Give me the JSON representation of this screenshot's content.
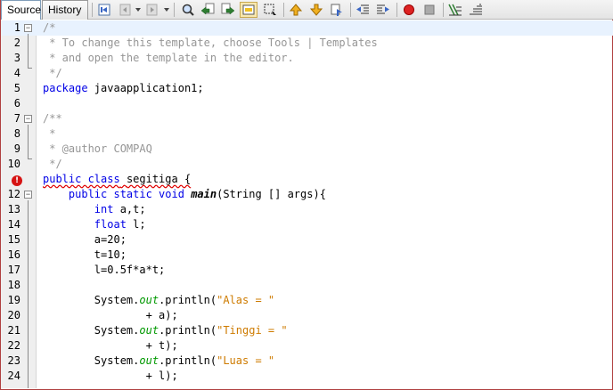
{
  "tabs": {
    "source": "Source",
    "history": "History"
  },
  "toolbar_icons": [
    "last-edit-icon",
    "back-icon",
    "forward-icon",
    "find-icon",
    "find-previous-icon",
    "find-next-icon",
    "toggle-highlight-icon",
    "toggle-rectangular-selection-icon",
    "previous-bookmark-icon",
    "next-bookmark-icon",
    "toggle-bookmark-icon",
    "shift-left-icon",
    "shift-right-icon",
    "start-macro-icon",
    "stop-macro-icon",
    "comment-icon",
    "uncomment-icon"
  ],
  "colors": {
    "keyword": "#0000e6",
    "comment": "#969696",
    "string": "#ce7b00",
    "static_field": "#009900",
    "error": "#d61414",
    "current_line": "#e8f2fe"
  },
  "lines": [
    {
      "n": "1",
      "segments": [
        {
          "t": "/*",
          "c": "cm"
        }
      ]
    },
    {
      "n": "2",
      "segments": [
        {
          "t": " * To change this template, choose Tools | Templates",
          "c": "cm"
        }
      ]
    },
    {
      "n": "3",
      "segments": [
        {
          "t": " * and open the template in the editor.",
          "c": "cm"
        }
      ]
    },
    {
      "n": "4",
      "segments": [
        {
          "t": " */",
          "c": "cm"
        }
      ]
    },
    {
      "n": "5",
      "segments": [
        {
          "t": "package",
          "c": "kw"
        },
        {
          "t": " javaapplication1;",
          "c": ""
        }
      ]
    },
    {
      "n": "6",
      "segments": []
    },
    {
      "n": "7",
      "segments": [
        {
          "t": "/**",
          "c": "cm"
        }
      ]
    },
    {
      "n": "8",
      "segments": [
        {
          "t": " *",
          "c": "cm"
        }
      ]
    },
    {
      "n": "9",
      "segments": [
        {
          "t": " * @author COMPAQ",
          "c": "cm"
        }
      ]
    },
    {
      "n": "10",
      "segments": [
        {
          "t": " */",
          "c": "cm"
        }
      ]
    },
    {
      "n": "",
      "segments": [
        {
          "t": "public class",
          "c": "kw err-text"
        },
        {
          "t": " ",
          "c": "err-text"
        },
        {
          "t": "segitiga {",
          "c": "err-text"
        }
      ]
    },
    {
      "n": "12",
      "segments": [
        {
          "t": "    ",
          "c": ""
        },
        {
          "t": "public static void",
          "c": "kw"
        },
        {
          "t": " ",
          "c": ""
        },
        {
          "t": "main",
          "c": "mth"
        },
        {
          "t": "(String [] args){",
          "c": ""
        }
      ]
    },
    {
      "n": "13",
      "segments": [
        {
          "t": "        ",
          "c": ""
        },
        {
          "t": "int",
          "c": "kw"
        },
        {
          "t": " a,t;",
          "c": ""
        }
      ]
    },
    {
      "n": "14",
      "segments": [
        {
          "t": "        ",
          "c": ""
        },
        {
          "t": "float",
          "c": "kw"
        },
        {
          "t": " l;",
          "c": ""
        }
      ]
    },
    {
      "n": "15",
      "segments": [
        {
          "t": "        a=20;",
          "c": ""
        }
      ]
    },
    {
      "n": "16",
      "segments": [
        {
          "t": "        t=10;",
          "c": ""
        }
      ]
    },
    {
      "n": "17",
      "segments": [
        {
          "t": "        l=0.5f*a*t;",
          "c": ""
        }
      ]
    },
    {
      "n": "18",
      "segments": []
    },
    {
      "n": "19",
      "segments": [
        {
          "t": "        System.",
          "c": ""
        },
        {
          "t": "out",
          "c": "fld"
        },
        {
          "t": ".println(",
          "c": ""
        },
        {
          "t": "\"Alas = \"",
          "c": "str"
        }
      ]
    },
    {
      "n": "20",
      "segments": [
        {
          "t": "                + a);",
          "c": ""
        }
      ]
    },
    {
      "n": "21",
      "segments": [
        {
          "t": "        System.",
          "c": ""
        },
        {
          "t": "out",
          "c": "fld"
        },
        {
          "t": ".println(",
          "c": ""
        },
        {
          "t": "\"Tinggi = \"",
          "c": "str"
        }
      ]
    },
    {
      "n": "22",
      "segments": [
        {
          "t": "                + t);",
          "c": ""
        }
      ]
    },
    {
      "n": "23",
      "segments": [
        {
          "t": "        System.",
          "c": ""
        },
        {
          "t": "out",
          "c": "fld"
        },
        {
          "t": ".println(",
          "c": ""
        },
        {
          "t": "\"Luas = \"",
          "c": "str"
        }
      ]
    },
    {
      "n": "24",
      "segments": [
        {
          "t": "                + l);",
          "c": ""
        }
      ]
    }
  ]
}
